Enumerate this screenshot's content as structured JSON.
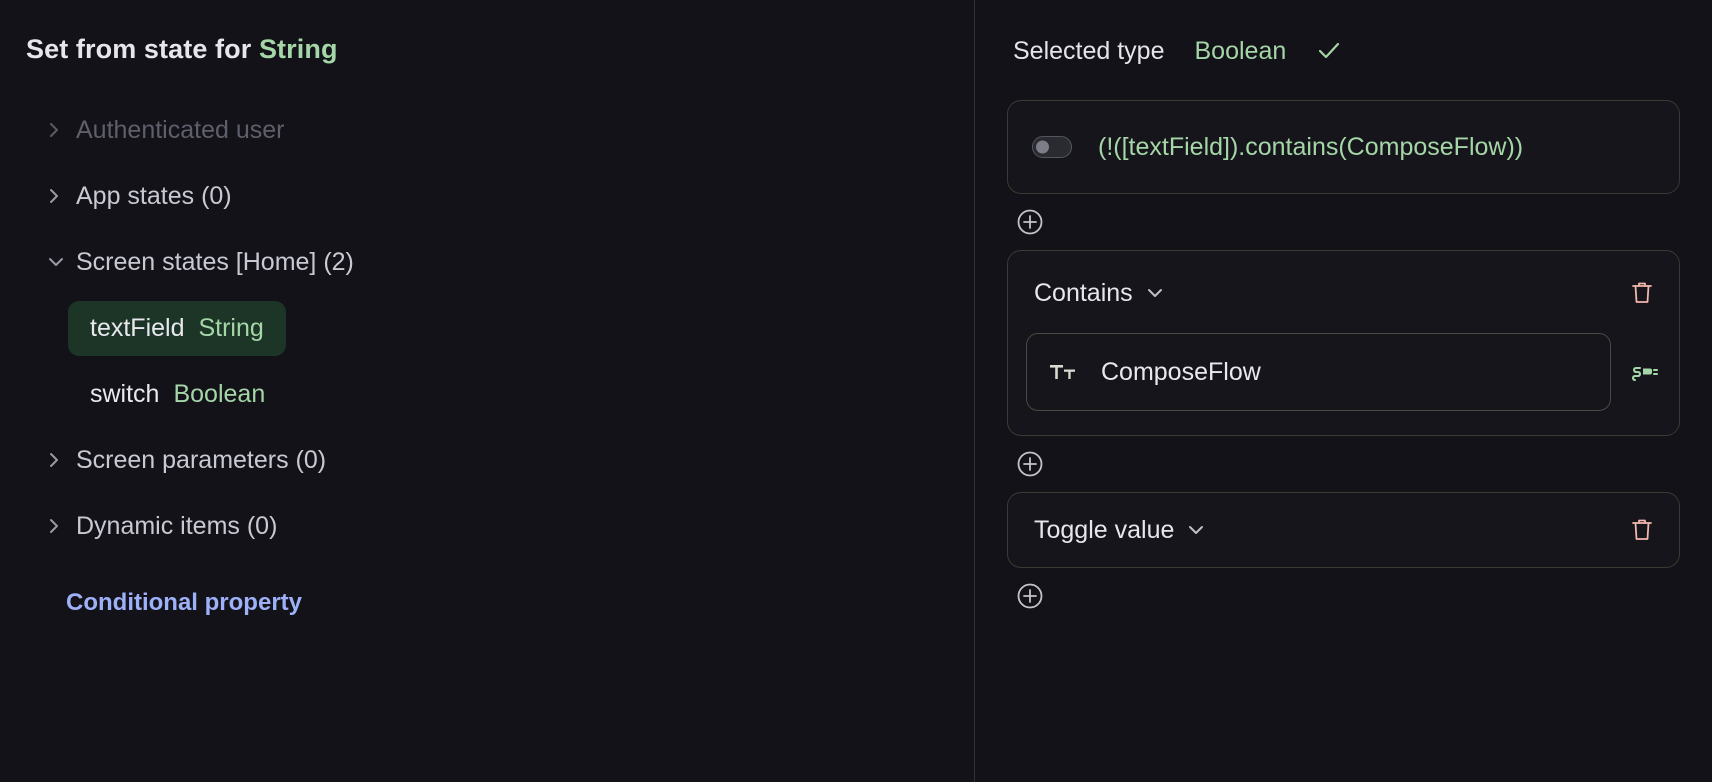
{
  "left": {
    "title_prefix": "Set from state for",
    "title_type": "String",
    "tree": [
      {
        "label": "Authenticated user",
        "expanded": false,
        "disabled": true,
        "icon": "chevron-right-icon"
      },
      {
        "label": "App states (0)",
        "expanded": false,
        "disabled": false,
        "icon": "chevron-right-icon"
      },
      {
        "label": "Screen states [Home] (2)",
        "expanded": true,
        "disabled": false,
        "icon": "chevron-down-icon"
      }
    ],
    "screen_states": [
      {
        "name": "textField",
        "type": "String",
        "selected": true
      },
      {
        "name": "switch",
        "type": "Boolean",
        "selected": false
      }
    ],
    "tree_after": [
      {
        "label": "Screen parameters (0)",
        "expanded": false,
        "disabled": false,
        "icon": "chevron-right-icon"
      },
      {
        "label": "Dynamic items (0)",
        "expanded": false,
        "disabled": false,
        "icon": "chevron-right-icon"
      }
    ],
    "conditional_property_link": "Conditional property"
  },
  "right": {
    "selected_type_label": "Selected type",
    "selected_type_value": "Boolean",
    "check_icon": "check-icon",
    "expression": {
      "toggle_icon": "toggle-off-icon",
      "text": "(!([textField]).contains(ComposeFlow))"
    },
    "add_button_label": "+",
    "condition_card": {
      "operator": "Contains",
      "caret_icon": "chevron-down-icon",
      "delete_icon": "trash-icon",
      "field": {
        "type_icon": "text-format-icon",
        "value": "ComposeFlow",
        "bind_icon": "plug-icon"
      }
    },
    "action_card": {
      "operator": "Toggle value",
      "caret_icon": "chevron-down-icon",
      "delete_icon": "trash-icon"
    }
  },
  "colors": {
    "background": "#121218",
    "accent_green": "#a5d6a7",
    "chip_bg": "#1d3527",
    "link_blue": "#9eb0f7",
    "danger": "#f2b7ac",
    "border": "#3a3a33"
  }
}
